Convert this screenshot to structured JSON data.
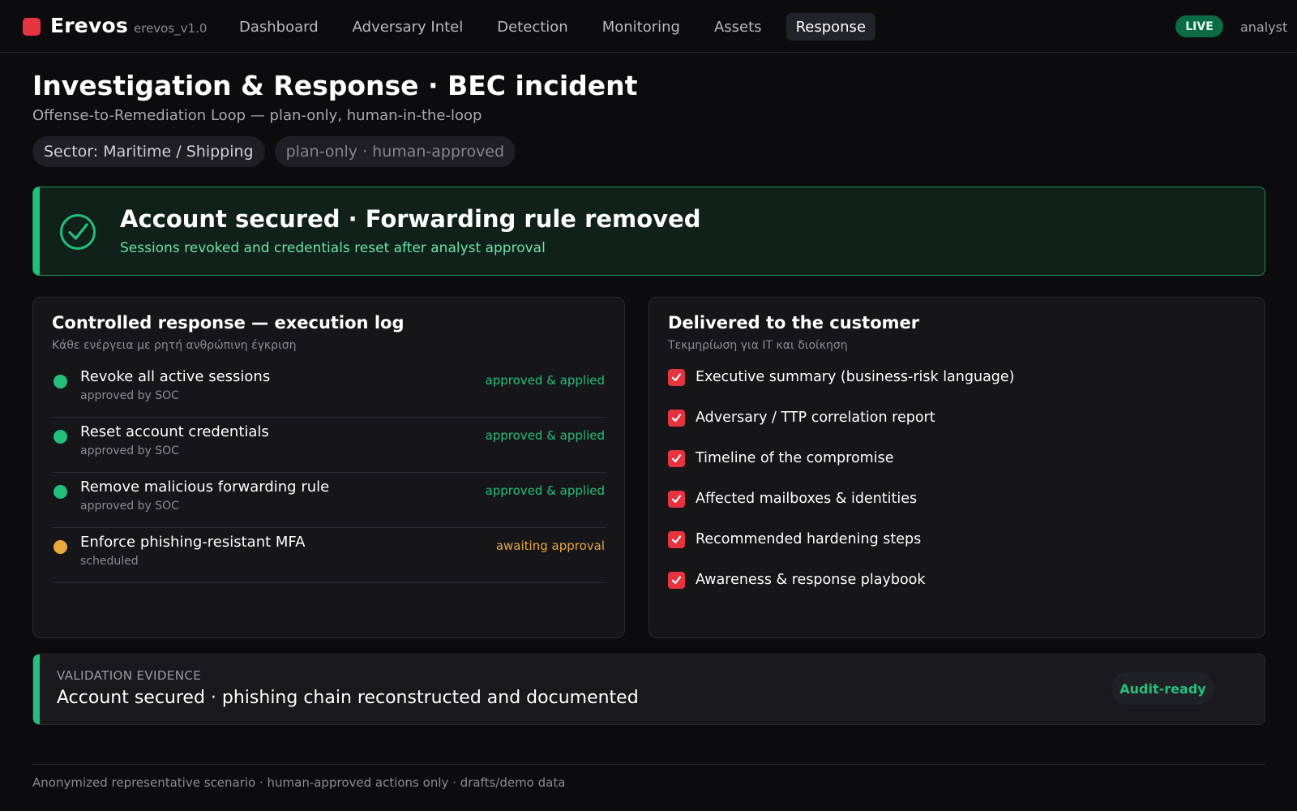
{
  "app": {
    "brand": "Erevos",
    "version": "erevos_v1.0",
    "live_label": "LIVE",
    "user": "analyst"
  },
  "nav": {
    "tabs": [
      {
        "label": "Dashboard",
        "active": false
      },
      {
        "label": "Adversary Intel",
        "active": false
      },
      {
        "label": "Detection",
        "active": false
      },
      {
        "label": "Monitoring",
        "active": false
      },
      {
        "label": "Assets",
        "active": false
      },
      {
        "label": "Response",
        "active": true
      }
    ]
  },
  "header": {
    "title": "Investigation & Response · BEC incident",
    "subtitle": "Offense-to-Remediation Loop — plan-only, human-in-the-loop",
    "chips": [
      "Sector: Maritime / Shipping",
      "plan-only · human-approved"
    ]
  },
  "banner": {
    "icon": "check-circle-icon",
    "title": "Account secured · Forwarding rule removed",
    "subtitle": "Sessions revoked and credentials reset after analyst approval"
  },
  "execution_log": {
    "title": "Controlled response — execution log",
    "subtitle": "Κάθε ενέργεια με ρητή ανθρώπινη έγκριση",
    "items": [
      {
        "name": "Revoke all active sessions",
        "by": "approved by SOC",
        "status": "approved & applied",
        "state": "ok"
      },
      {
        "name": "Reset account credentials",
        "by": "approved by SOC",
        "status": "approved & applied",
        "state": "ok"
      },
      {
        "name": "Remove malicious forwarding rule",
        "by": "approved by SOC",
        "status": "approved & applied",
        "state": "ok"
      },
      {
        "name": "Enforce phishing-resistant MFA",
        "by": "scheduled",
        "status": "awaiting approval",
        "state": "wait"
      }
    ]
  },
  "deliverables": {
    "title": "Delivered to the customer",
    "subtitle": "Τεκμηρίωση για IT και διοίκηση",
    "items": [
      "Executive summary (business-risk language)",
      "Adversary / TTP correlation report",
      "Timeline of the compromise",
      "Affected mailboxes & identities",
      "Recommended hardening steps",
      "Awareness & response playbook"
    ]
  },
  "evidence": {
    "label": "VALIDATION EVIDENCE",
    "text": "Account secured · phishing chain reconstructed and documented",
    "badge": "Audit-ready"
  },
  "footer": {
    "text": "Anonymized representative scenario · human-approved actions only · drafts/demo data"
  },
  "colors": {
    "accent_red": "#e5333f",
    "success_green": "#22c07a",
    "warning_amber": "#eaa83a",
    "live_badge": "#0a6b45",
    "background": "#0c0c0f"
  }
}
